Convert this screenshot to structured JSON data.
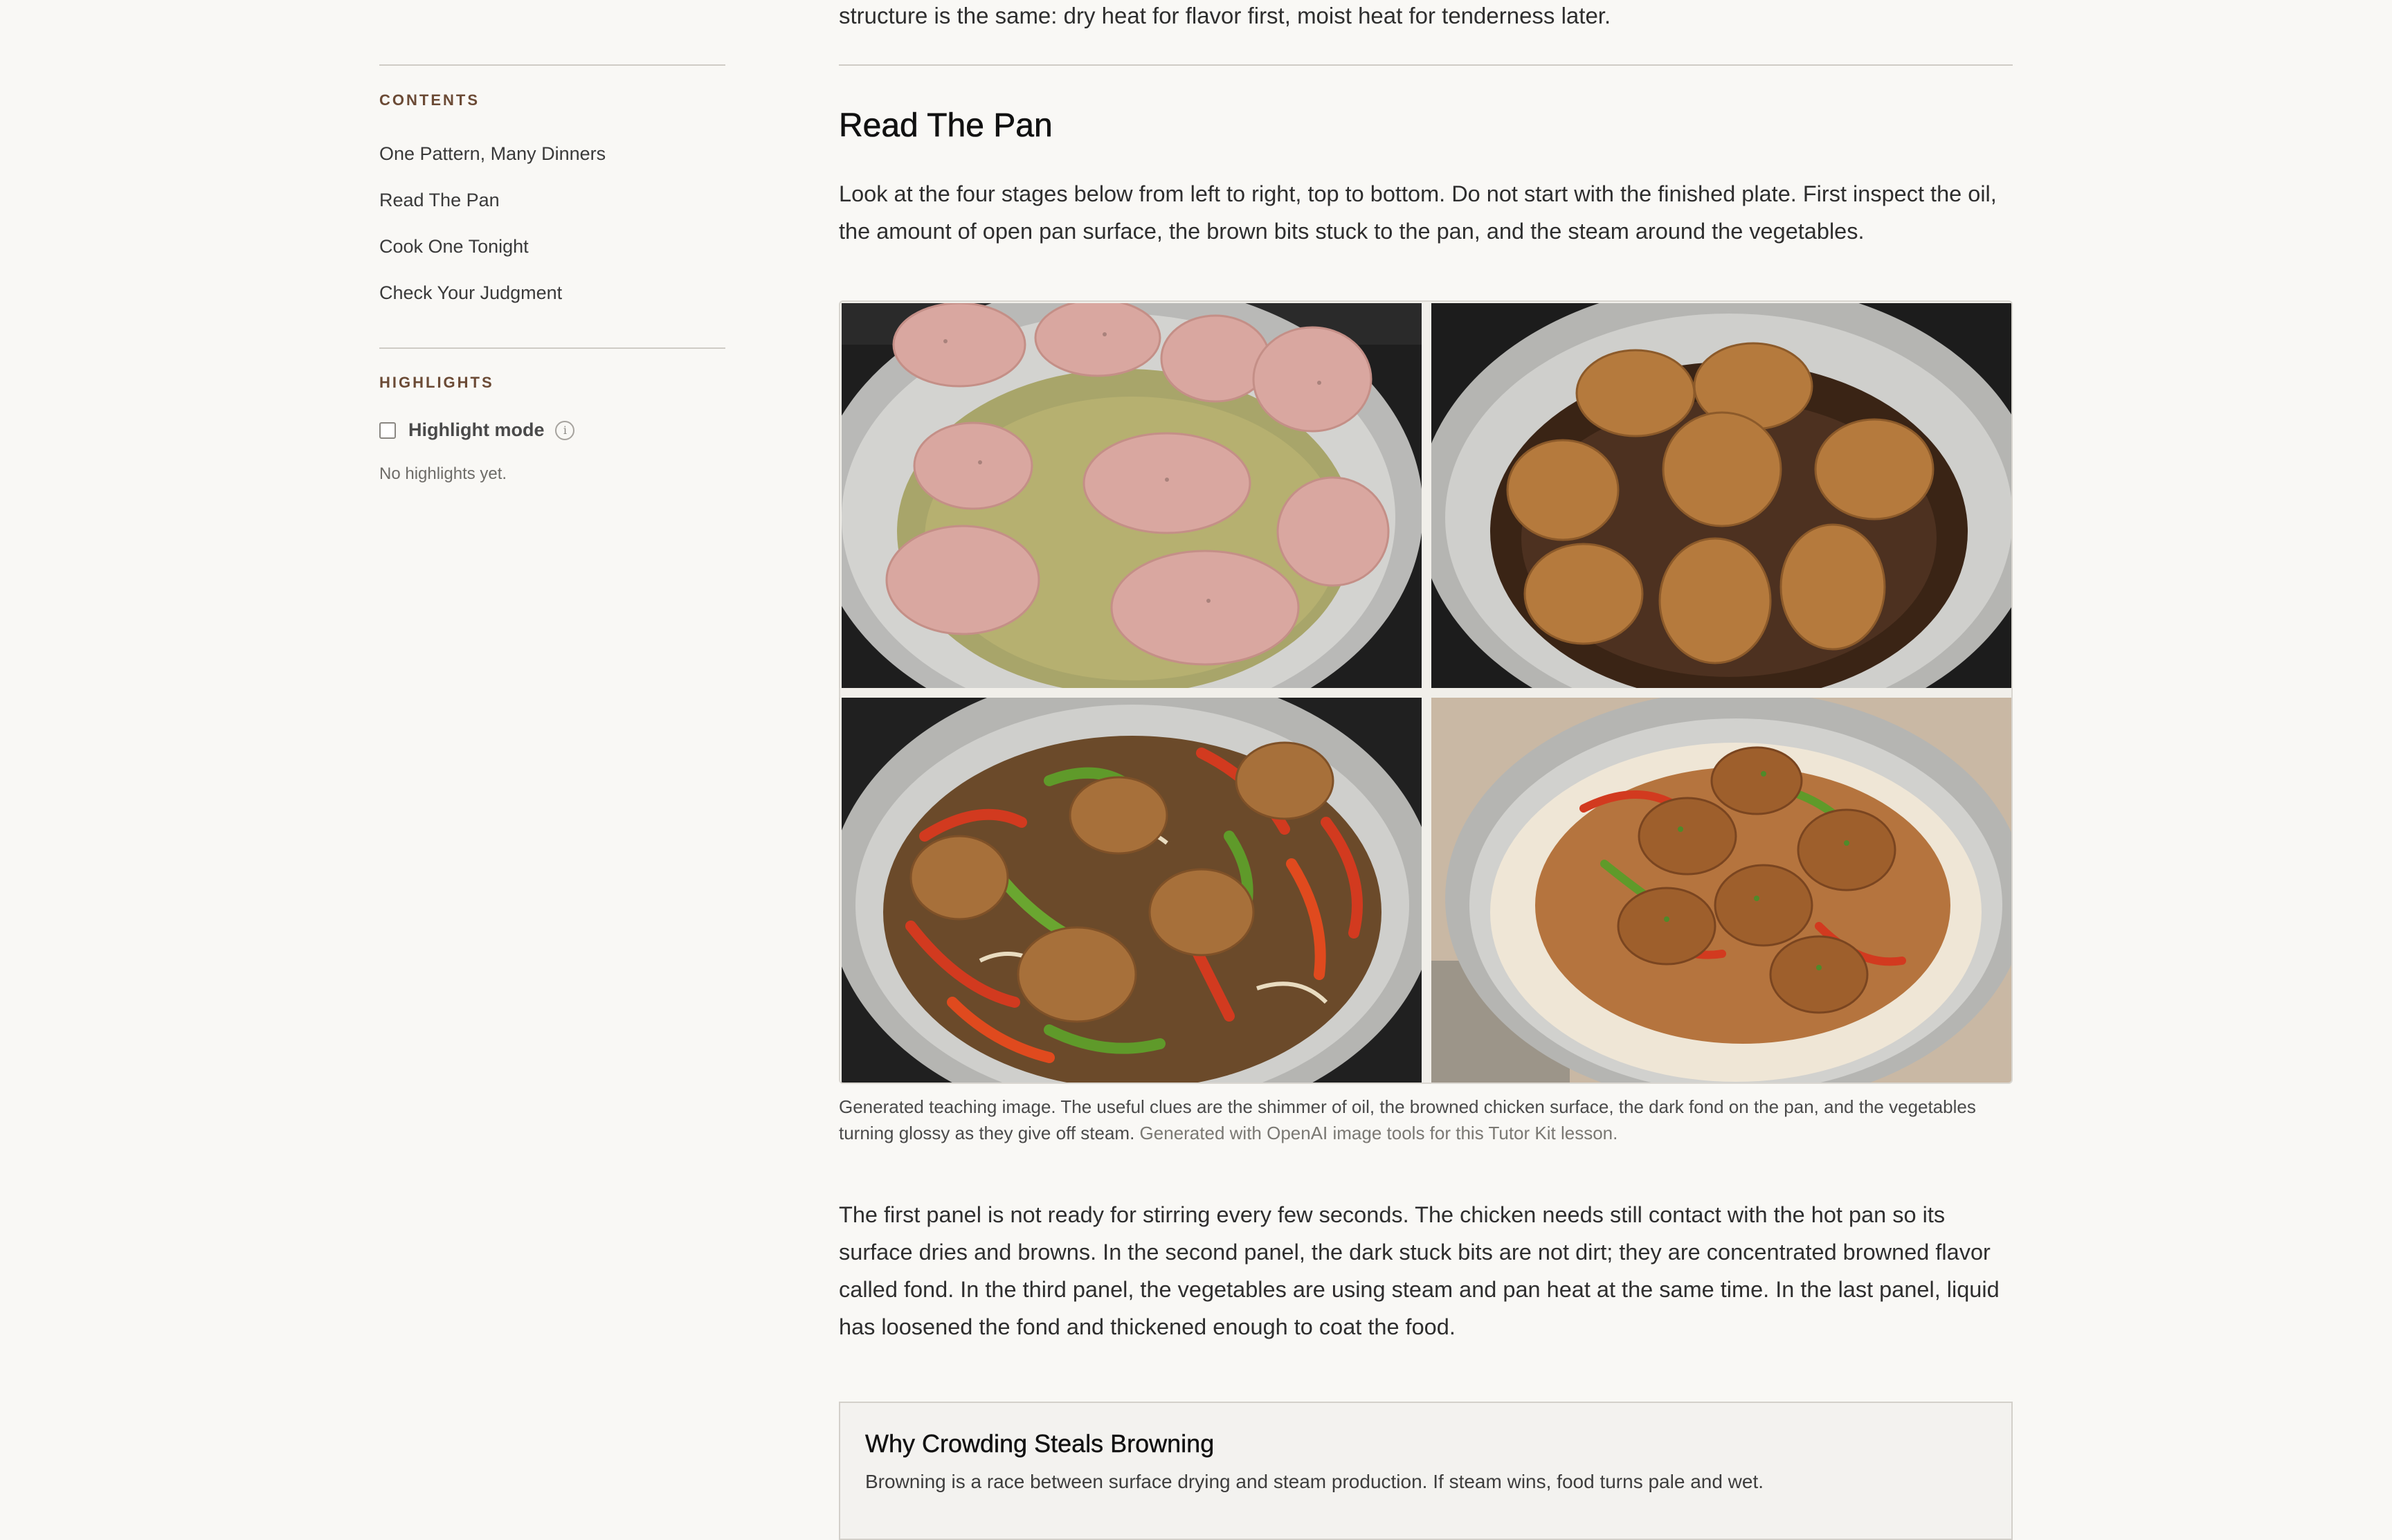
{
  "sidebar": {
    "contents_heading": "CONTENTS",
    "toc": [
      "One Pattern, Many Dinners",
      "Read The Pan",
      "Cook One Tonight",
      "Check Your Judgment"
    ],
    "highlights_heading": "HIGHLIGHTS",
    "highlight_mode_label": "Highlight mode",
    "highlight_mode_checked": false,
    "info_icon": "i",
    "empty_state": "No highlights yet."
  },
  "main": {
    "intro_tail": "structure is the same: dry heat for flavor first, moist heat for tenderness later.",
    "section_title": "Read The Pan",
    "lead": "Look at the four stages below from left to right, top to bottom. Do not start with the finished plate. First inspect the oil, the amount of open pan surface, the brown bits stuck to the pan, and the steam around the vegetables.",
    "figure": {
      "panels": [
        "raw-chicken-in-oil",
        "browned-chicken-with-fond",
        "chicken-with-peppers-and-onions",
        "finished-chicken-over-rice"
      ],
      "caption": "Generated teaching image. The useful clues are the shimmer of oil, the browned chicken surface, the dark fond on the pan, and the vegetables turning glossy as they give off steam.",
      "credit": "Generated with OpenAI image tools for this Tutor Kit lesson."
    },
    "body": "The first panel is not ready for stirring every few seconds. The chicken needs still contact with the hot pan so its surface dries and browns. In the second panel, the dark stuck bits are not dirt; they are concentrated browned flavor called fond. In the third panel, the vegetables are using steam and pan heat at the same time. In the last panel, liquid has loosened the fond and thickened enough to coat the food.",
    "callout": {
      "title": "Why Crowding Steals Browning",
      "text": "Browning is a race between surface drying and steam production. If steam wins, food turns pale and wet."
    }
  },
  "colors": {
    "background": "#f9f8f5",
    "section_label": "#6b4a35",
    "rule": "#cfccc6"
  }
}
